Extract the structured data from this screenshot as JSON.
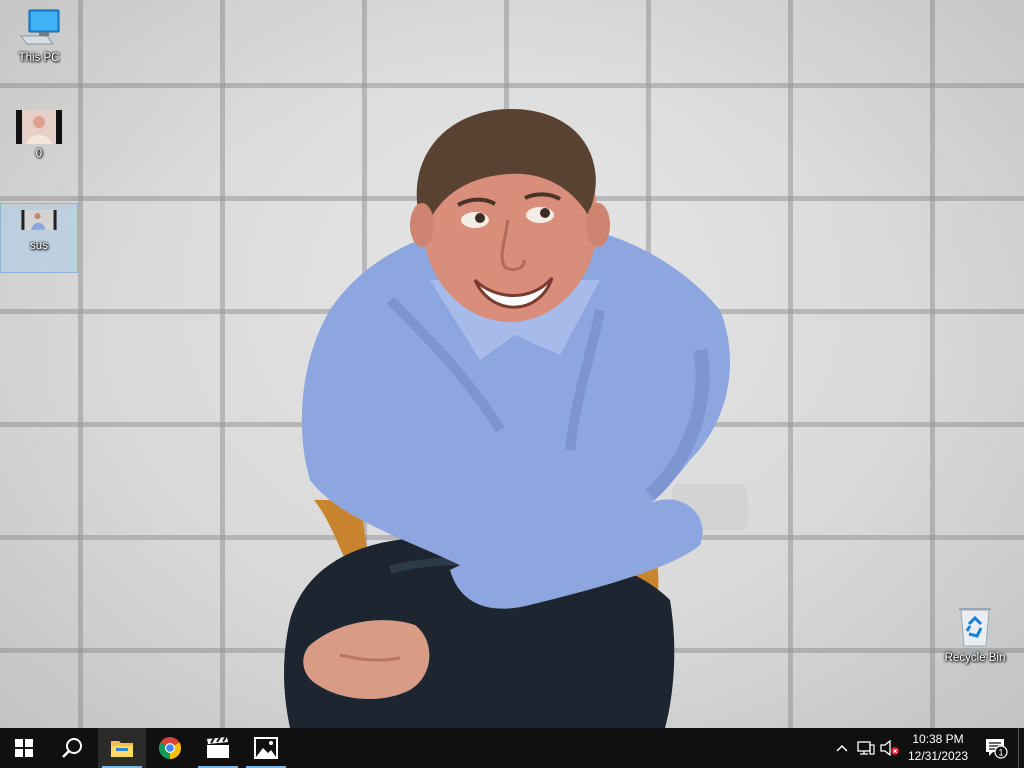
{
  "desktop": {
    "icons": [
      {
        "label": "This PC",
        "icon": "computer-icon"
      },
      {
        "label": "0",
        "icon": "image-thumbnail"
      },
      {
        "label": "sus",
        "icon": "image-thumbnail",
        "selected": true
      },
      {
        "label": "Recycle Bin",
        "icon": "recycle-bin-icon"
      }
    ]
  },
  "taskbar": {
    "pinned": [
      {
        "name": "start",
        "icon": "windows-logo-icon"
      },
      {
        "name": "search",
        "icon": "search-icon"
      },
      {
        "name": "file-explorer",
        "icon": "folder-icon",
        "active": true
      },
      {
        "name": "chrome",
        "icon": "chrome-icon"
      },
      {
        "name": "movies-tv",
        "icon": "clapperboard-icon",
        "running": true
      },
      {
        "name": "photos",
        "icon": "photos-icon",
        "running": true
      }
    ],
    "tray": {
      "time": "10:38 PM",
      "date": "12/31/2023",
      "notification_count": "1"
    }
  },
  "colors": {
    "taskbar_bg": "#101010",
    "accent": "#76b9ed",
    "shirt": "#8ea6e0"
  }
}
